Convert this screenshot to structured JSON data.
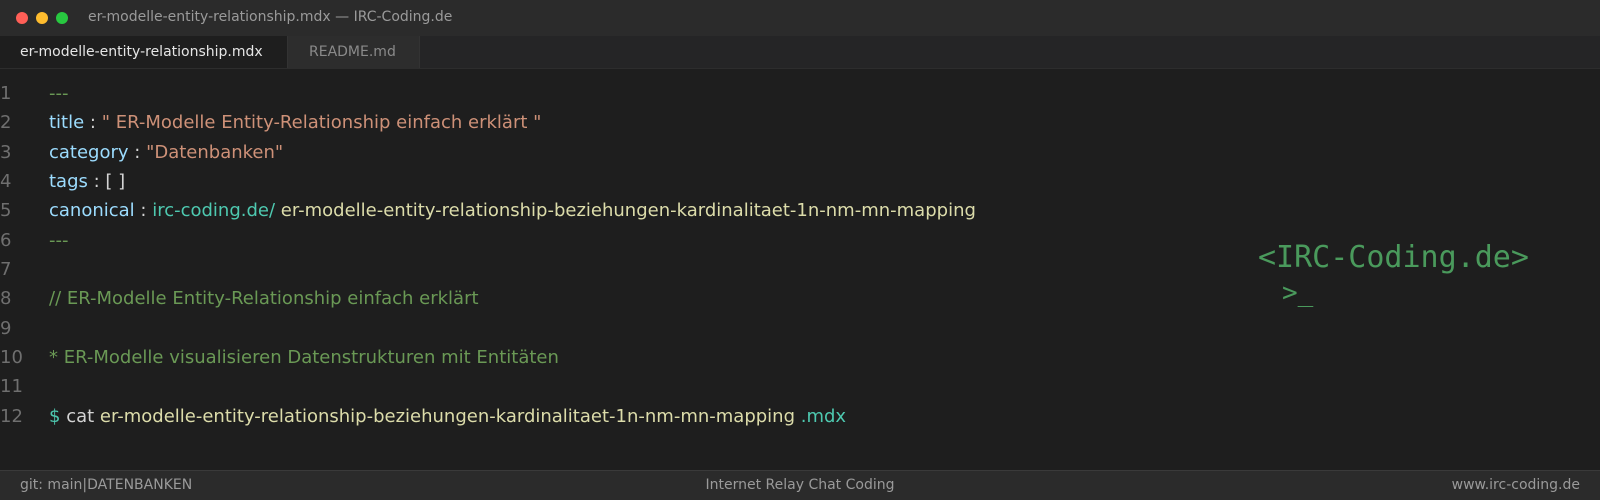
{
  "window": {
    "title": "er-modelle-entity-relationship.mdx — IRC-Coding.de"
  },
  "tabs": [
    {
      "label": "er-modelle-entity-relationship.mdx",
      "active": true
    },
    {
      "label": "README.md",
      "active": false
    }
  ],
  "editor": {
    "line_numbers": [
      "1",
      "2",
      "3",
      "4",
      "5",
      "6",
      "7",
      "8",
      "9",
      "10",
      "11",
      "12"
    ],
    "frontmatter": {
      "delimiter": "---",
      "title_key": "title",
      "title_value": "\" ER-Modelle Entity-Relationship einfach erklärt \"",
      "category_key": "category",
      "category_value": "\"Datenbanken\"",
      "tags_key": "tags",
      "tags_value": "[ ]",
      "canonical_key": "canonical",
      "canonical_domain": "irc-coding.de/",
      "canonical_path": "er-modelle-entity-relationship-beziehungen-kardinalitaet-1n-nm-mn-mapping",
      "separator": " : "
    },
    "comment_line": "// ER-Modelle Entity-Relationship einfach erklärt",
    "bullet_line": "* ER-Modelle visualisieren Datenstrukturen mit Entitäten",
    "command": {
      "prompt": "$",
      "cmd": "cat",
      "file": "er-modelle-entity-relationship-beziehungen-kardinalitaet-1n-nm-mn-mapping",
      "ext": ".mdx"
    }
  },
  "brand": {
    "logo_text": "<IRC-Coding.de>",
    "prompt_text": ">_"
  },
  "statusbar": {
    "branch": "git: main",
    "separator": "|",
    "section": "DATENBANKEN",
    "center": "Internet Relay Chat Coding",
    "right": "www.irc-coding.de"
  },
  "colors": {
    "background": "#1e1e1e",
    "key": "#9cdcfe",
    "string": "#ce9178",
    "url": "#4ec9b0",
    "path": "#dcdcaa",
    "comment": "#6a9955",
    "brand": "#4a9a5c"
  }
}
